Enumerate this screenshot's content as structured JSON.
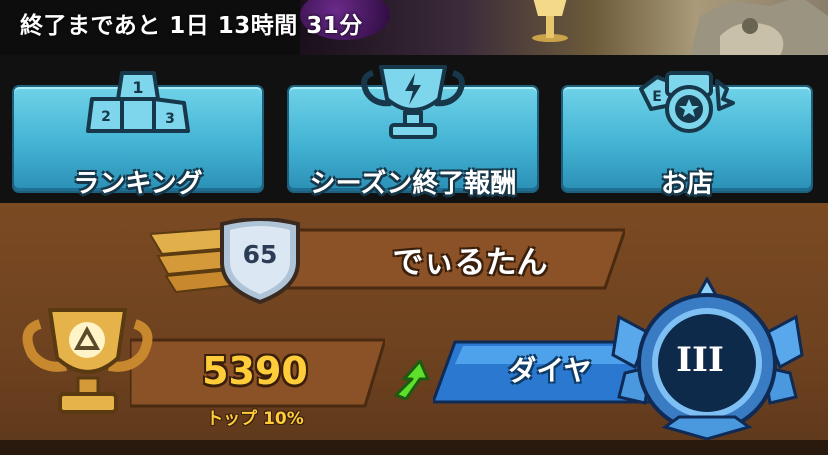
{
  "header": {
    "season_timer": "終了まであと 1日 13時間 31分"
  },
  "menu": {
    "ranking_label": "ランキング",
    "season_reward_label": "シーズン終了報酬",
    "shop_label": "お店"
  },
  "player": {
    "level": "65",
    "name": "でぃるたん"
  },
  "trophies": {
    "count": "5390",
    "rank_percent": "トップ 10%"
  },
  "league": {
    "name": "ダイヤ",
    "division": "III"
  },
  "colors": {
    "menu_button": "#43b3d4",
    "panel_brown": "#6e4220",
    "trophy_gold": "#ffcc3a",
    "league_blue": "#2a78d0",
    "arrow_green": "#5ee02a"
  },
  "icons": [
    "podium-icon",
    "trophy-lightning-icon",
    "shop-coins-icon",
    "gold-trophy-icon",
    "up-arrow-icon",
    "diamond-league-emblem"
  ]
}
